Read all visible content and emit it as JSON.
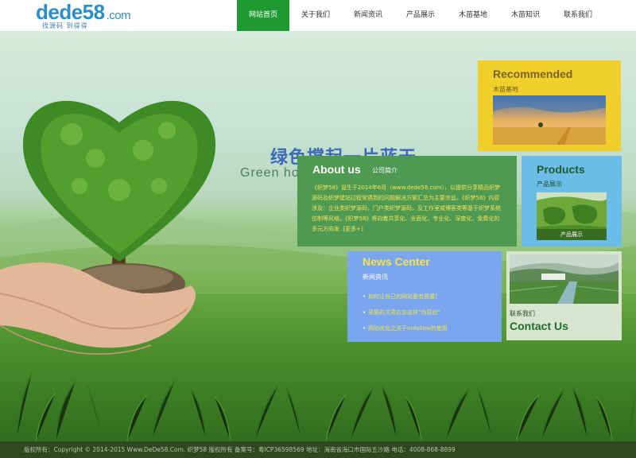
{
  "header": {
    "logo_text": "dede58",
    "logo_suffix": ".com",
    "logo_tagline": "找源码 到得得"
  },
  "nav": {
    "items": [
      {
        "label": "网站首页",
        "active": true
      },
      {
        "label": "关于我们",
        "active": false
      },
      {
        "label": "新闻资讯",
        "active": false
      },
      {
        "label": "产品展示",
        "active": false
      },
      {
        "label": "木苗基地",
        "active": false
      },
      {
        "label": "木苗知识",
        "active": false
      },
      {
        "label": "联系我们",
        "active": false
      }
    ]
  },
  "hero": {
    "slogan_cn": "绿色撑起一片蓝天",
    "slogan_en": "Green ho"
  },
  "recommended": {
    "title": "Recommended",
    "subtitle": "木苗基地"
  },
  "about": {
    "title": "About us",
    "subtitle": "公司简介",
    "description": "《织梦58》诞生于2014年6月（www.dede58.com），以提供分享精品织梦源码及织梦建站过程常遇到的问题解决方案汇总为主要宗旨。《织梦58》内容涉及：企业类织梦源码，门户类织梦源码，及工作室或博客类等基于织梦系统仿制等风格。《织梦58》将向着共享化、全面化、专业化、深度化、免费化的多元方向发..[更多+]"
  },
  "products": {
    "title": "Products",
    "subtitle": "产品展示",
    "caption": "产品展示"
  },
  "news": {
    "title": "News Center",
    "subtitle": "新闻资讯",
    "items": [
      "如何让自己的网站更有质量？",
      "采集的文章应该这样\"伪原创\"",
      "网站优化之关于nofollow的使用"
    ]
  },
  "contact": {
    "subtitle": "联系我们",
    "title": "Contact Us"
  },
  "footer": {
    "text": "版权所有：Copyright © 2014-2015 Www.DeDe58.Com. 织梦58 版权所有    备案号：粤ICP36598569    地址：海南省海口市国际五沙路    电话：4008-868-8899"
  },
  "colors": {
    "nav_active": "#1f9a32",
    "recommended_bg": "#f0cf2a",
    "about_bg": "#4f9a52",
    "products_bg": "#6bbde8",
    "news_bg": "#7aa6f0",
    "contact_bg": "#d8e6cf"
  }
}
